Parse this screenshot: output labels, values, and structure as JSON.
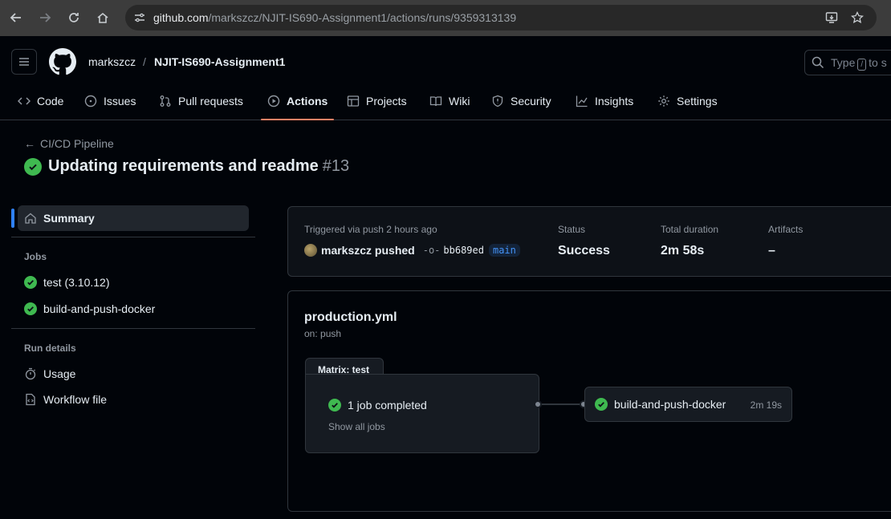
{
  "browser": {
    "url_host": "github.com",
    "url_path": "/markszcz/NJIT-IS690-Assignment1/actions/runs/9359313139"
  },
  "header": {
    "owner": "markszcz",
    "separator": "/",
    "repo": "NJIT-IS690-Assignment1",
    "search_prefix": "Type",
    "search_key": "/",
    "search_suffix": "to s"
  },
  "tabs": [
    {
      "label": "Code",
      "icon": "code-icon"
    },
    {
      "label": "Issues",
      "icon": "issue-icon"
    },
    {
      "label": "Pull requests",
      "icon": "pull-request-icon"
    },
    {
      "label": "Actions",
      "icon": "play-icon",
      "active": true
    },
    {
      "label": "Projects",
      "icon": "table-icon"
    },
    {
      "label": "Wiki",
      "icon": "book-icon"
    },
    {
      "label": "Security",
      "icon": "shield-icon"
    },
    {
      "label": "Insights",
      "icon": "graph-icon"
    },
    {
      "label": "Settings",
      "icon": "gear-icon"
    }
  ],
  "run": {
    "workflow_link": "CI/CD Pipeline",
    "title": "Updating requirements and readme",
    "number": "#13"
  },
  "sidebar": {
    "summary": "Summary",
    "jobs_heading": "Jobs",
    "jobs": [
      "test (3.10.12)",
      "build-and-push-docker"
    ],
    "run_details_heading": "Run details",
    "details": [
      "Usage",
      "Workflow file"
    ]
  },
  "summary": {
    "trigger_label": "Triggered via push 2 hours ago",
    "actor_text": "markszcz pushed",
    "commit_sha": "bb689ed",
    "branch": "main",
    "status_label": "Status",
    "status_value": "Success",
    "duration_label": "Total duration",
    "duration_value": "2m 58s",
    "artifacts_label": "Artifacts",
    "artifacts_value": "–"
  },
  "graph": {
    "workflow_file": "production.yml",
    "trigger": "on: push",
    "matrix_label": "Matrix: test",
    "matrix_status": "1 job completed",
    "matrix_show_all": "Show all jobs",
    "job_name": "build-and-push-docker",
    "job_duration": "2m 19s"
  },
  "colors": {
    "success": "#3fb950",
    "accent_underline": "#f78166",
    "link_blue": "#4493f8"
  }
}
